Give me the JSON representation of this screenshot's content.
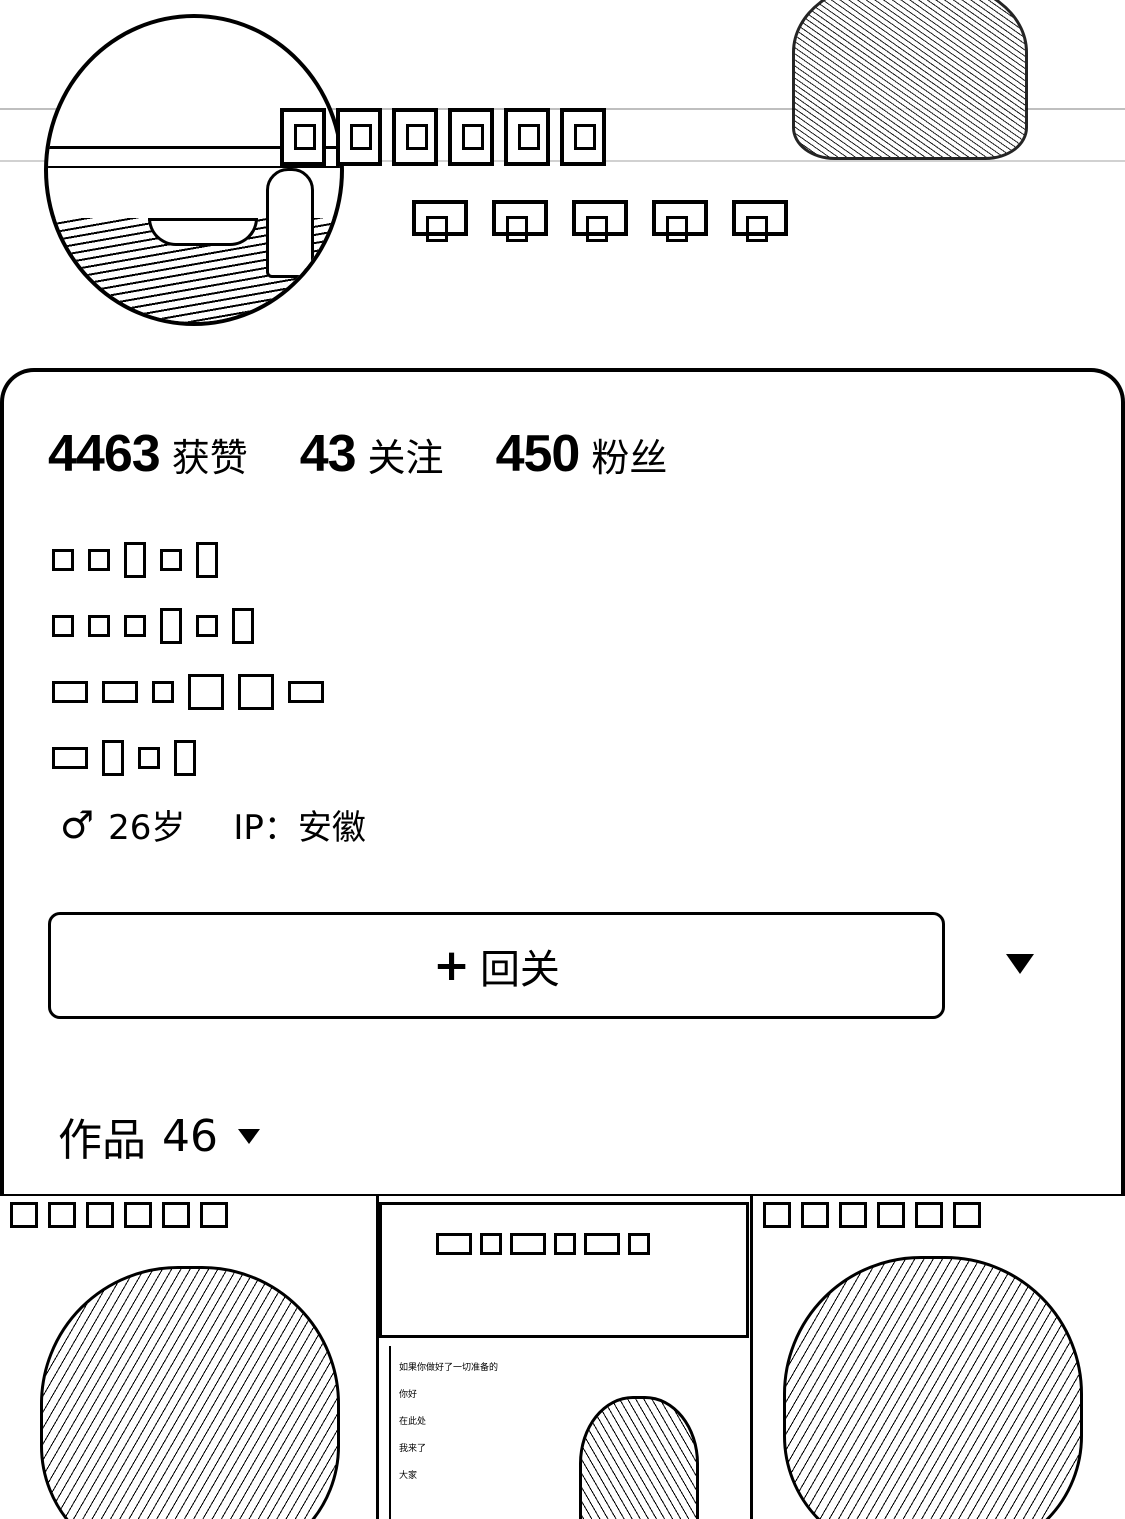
{
  "stats": {
    "likes": {
      "value": "4463",
      "label": "获赞"
    },
    "following": {
      "value": "43",
      "label": "关注"
    },
    "followers": {
      "value": "450",
      "label": "粉丝"
    }
  },
  "meta": {
    "gender_icon": "♂",
    "age": "26岁",
    "ip_label": "IP：",
    "ip_location": "安徽"
  },
  "actions": {
    "follow_plus": "+",
    "follow_label": "回关",
    "more_icon": "triangle-down-icon"
  },
  "works": {
    "label": "作品",
    "count": "46",
    "caret_icon": "caret-down-icon"
  },
  "thumbnails": [
    {
      "name": "video-thumb-1"
    },
    {
      "name": "video-thumb-2",
      "doc_lines": [
        "如果你做好了一切准备的",
        "你好",
        "在此处",
        "我来了",
        "大家"
      ]
    },
    {
      "name": "video-thumb-3"
    }
  ]
}
